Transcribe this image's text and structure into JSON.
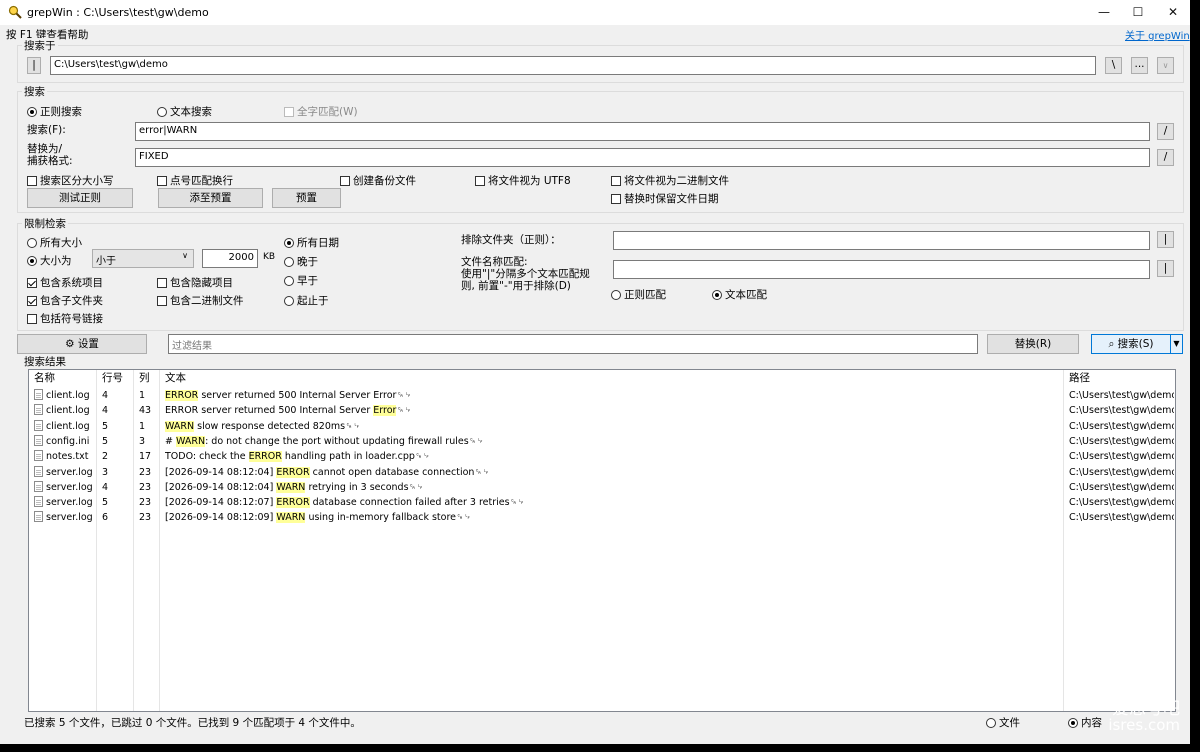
{
  "window": {
    "title": "grepWin : C:\\Users\\test\\gw\\demo",
    "minimize": "—",
    "maximize": "☐",
    "close": "✕"
  },
  "help_hint": "按 F1 键查看帮助",
  "about_link": "关于 grepWin",
  "search_in": {
    "group_title": "搜索于",
    "toggle_label": "|",
    "path": "C:\\Users\\test\\gw\\demo",
    "backslash_button": "\\",
    "browse_button": "...",
    "dropdown_button": "∨"
  },
  "search": {
    "group_title": "搜索",
    "regex_label": "正则搜索",
    "text_label": "文本搜索",
    "whole_word_label": "全字匹配(W)",
    "search_label": "搜索(F):",
    "search_value": "error|WARN",
    "search_slash": "/",
    "replace_label_1": "替换为/",
    "replace_label_2": "捕获格式:",
    "replace_value": "FIXED",
    "replace_slash": "/",
    "case_sensitive": "搜索区分大小写",
    "dot_newline": "点号匹配换行",
    "backup": "创建备份文件",
    "utf8": "将文件视为 UTF8",
    "binary": "将文件视为二进制文件",
    "keep_date": "替换时保留文件日期",
    "test_regex_button": "测试正则",
    "add_preset_button": "添至预置",
    "preset_button": "预置"
  },
  "limit": {
    "group_title": "限制检索",
    "all_sizes": "所有大小",
    "size_is": "大小为",
    "size_op": "小于",
    "size_value": "2000",
    "size_unit": "KB",
    "include_system": "包含系统项目",
    "include_hidden": "包含隐藏项目",
    "include_subfolders": "包含子文件夹",
    "include_binary": "包含二进制文件",
    "include_symlinks": "包括符号链接",
    "all_dates": "所有日期",
    "newer": "晚于",
    "older": "早于",
    "between": "起止于",
    "exclude_dirs_label": "排除文件夹（正则）：",
    "exclude_dirs_value": "",
    "exclude_btn": "|",
    "file_match_label_1": "文件名称匹配:",
    "file_match_label_2": "使用\"|\"分隔多个文本匹配规",
    "file_match_label_3": "则, 前置\"-\"用于排除(D)",
    "file_match_value": "",
    "file_match_btn": "|",
    "regex_match": "正则匹配",
    "text_match": "文本匹配"
  },
  "toolbar": {
    "settings_button": "⚙ 设置",
    "filter_placeholder": "过滤结果",
    "replace_button": "替换(R)",
    "search_button": "⌕ 搜索(S)",
    "search_dropdown": "▼"
  },
  "results": {
    "group_title": "搜索结果",
    "columns": [
      "名称",
      "行号",
      "列",
      "文本",
      "路径"
    ],
    "rows": [
      {
        "name": "client.log",
        "line": "4",
        "col": "1",
        "pre": "",
        "match": "ERROR",
        "post": " server returned 500 Internal Server Error␍␊",
        "path": "C:\\Users\\test\\gw\\demo",
        "icon": "file-icon"
      },
      {
        "name": "client.log",
        "line": "4",
        "col": "43",
        "pre": "ERROR server returned 500 Internal Server ",
        "match": "Error",
        "post": "␍␊",
        "path": "C:\\Users\\test\\gw\\demo",
        "icon": "file-icon"
      },
      {
        "name": "client.log",
        "line": "5",
        "col": "1",
        "pre": "",
        "match": "WARN",
        "post": "  slow response detected 820ms␍␊",
        "path": "C:\\Users\\test\\gw\\demo",
        "icon": "file-icon"
      },
      {
        "name": "config.ini",
        "line": "5",
        "col": "3",
        "pre": "# ",
        "match": "WARN",
        "post": ": do not change the port without updating firewall rules␍␊",
        "path": "C:\\Users\\test\\gw\\demo",
        "icon": "settings-file-icon"
      },
      {
        "name": "notes.txt",
        "line": "2",
        "col": "17",
        "pre": "TODO: check the ",
        "match": "ERROR",
        "post": " handling path in loader.cpp␍␊",
        "path": "C:\\Users\\test\\gw\\demo",
        "icon": "file-icon"
      },
      {
        "name": "server.log",
        "line": "3",
        "col": "23",
        "pre": "[2026-09-14 08:12:04] ",
        "match": "ERROR",
        "post": " cannot open database connection␍␊",
        "path": "C:\\Users\\test\\gw\\demo",
        "icon": "file-icon"
      },
      {
        "name": "server.log",
        "line": "4",
        "col": "23",
        "pre": "[2026-09-14 08:12:04] ",
        "match": "WARN",
        "post": "  retrying in 3 seconds␍␊",
        "path": "C:\\Users\\test\\gw\\demo",
        "icon": "file-icon"
      },
      {
        "name": "server.log",
        "line": "5",
        "col": "23",
        "pre": "[2026-09-14 08:12:07] ",
        "match": "ERROR",
        "post": " database connection failed after 3 retries␍␊",
        "path": "C:\\Users\\test\\gw\\demo",
        "icon": "file-icon"
      },
      {
        "name": "server.log",
        "line": "6",
        "col": "23",
        "pre": "[2026-09-14 08:12:09] ",
        "match": "WARN",
        "post": "  using in-memory fallback store␍␊",
        "path": "C:\\Users\\test\\gw\\demo",
        "icon": "file-icon"
      }
    ]
  },
  "status": {
    "text": "已搜索 5 个文件，已跳过 0 个文件。已找到 9 个匹配项于 4 个文件中。",
    "files_radio": "文件",
    "content_radio": "内容"
  },
  "watermark": {
    "line1": "爱思考吧",
    "line2": "isres.com"
  },
  "colors": {
    "highlight": "#ffff99",
    "link": "#0066cc",
    "window_bg": "#f0f0f0"
  }
}
